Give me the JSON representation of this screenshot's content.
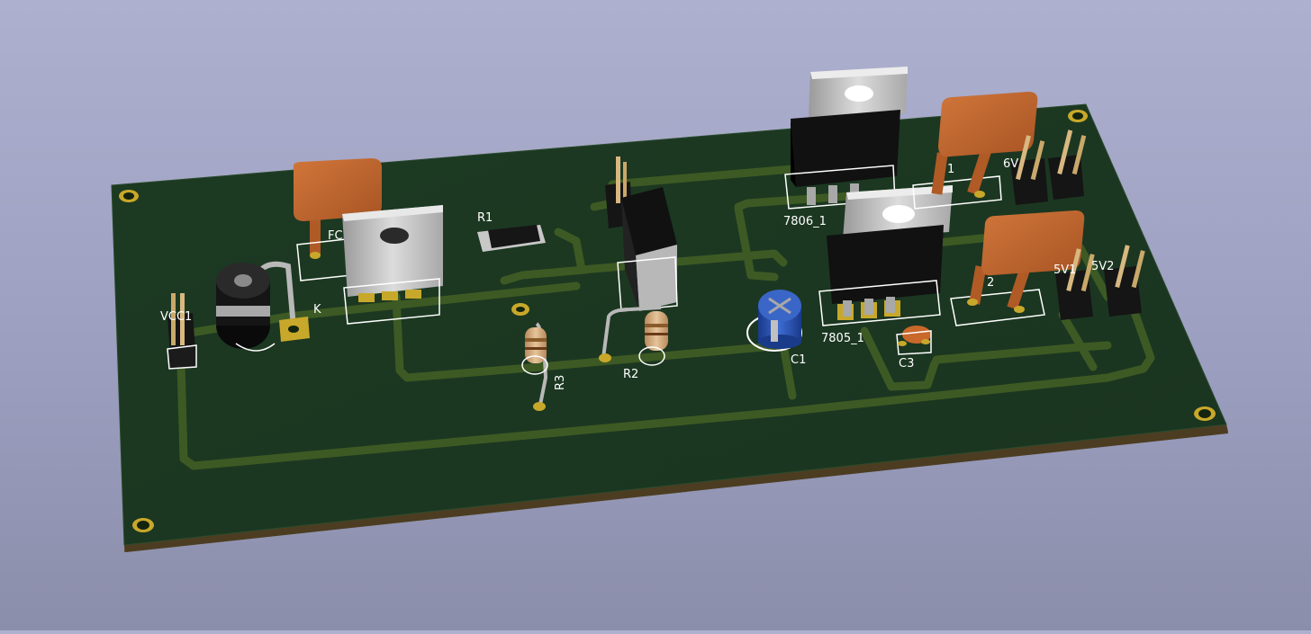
{
  "scene": {
    "background_top": "#aeb0cf",
    "background_bottom": "#8b8eaa",
    "board_color": "#1f3a22",
    "board_edge_color": "#5b4a2a",
    "trace_color": "#3f5a24",
    "silkscreen_color": "#ffffff",
    "pad_color": "#c8a82a"
  },
  "labels": {
    "vcc1": "VCC1",
    "k": "K",
    "fc": "FC",
    "r1": "R1",
    "r2": "R2",
    "r3": "R3",
    "c1": "C1",
    "c3": "C3",
    "u7806": "7806_1",
    "u7805": "7805_1",
    "six_v": "6V",
    "five_v1": "5V1",
    "five_v2": "5V2",
    "cap_label_1": "1",
    "cap_label_2": "2"
  }
}
